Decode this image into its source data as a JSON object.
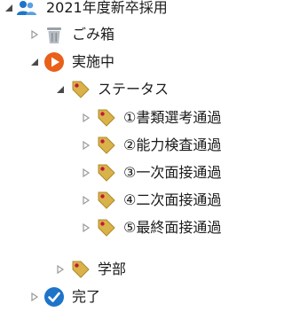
{
  "tree": {
    "root": {
      "label": "2021年度新卒採用",
      "icon": "people-icon",
      "expanded": true
    },
    "trash": {
      "label": "ごみ箱",
      "icon": "trash-icon",
      "expanded": false
    },
    "in_progress": {
      "label": "実施中",
      "icon": "play-circle-icon",
      "expanded": true
    },
    "status": {
      "label": "ステータス",
      "icon": "tag-icon",
      "expanded": true
    },
    "status_children": [
      {
        "label": "①書類選考通過",
        "icon": "tag-icon"
      },
      {
        "label": "②能力検査通過",
        "icon": "tag-icon"
      },
      {
        "label": "③一次面接通過",
        "icon": "tag-icon"
      },
      {
        "label": "④二次面接通過",
        "icon": "tag-icon"
      },
      {
        "label": "⑤最終面接通過",
        "icon": "tag-icon"
      }
    ],
    "department": {
      "label": "学部",
      "icon": "tag-icon",
      "expanded": false
    },
    "done": {
      "label": "完了",
      "icon": "check-circle-icon",
      "expanded": false
    }
  },
  "colors": {
    "people": "#1e74c9",
    "trash": "#9aa1a8",
    "play": "#e8601a",
    "tag": "#d9b24a",
    "tag_dot": "#c2183a",
    "check": "#1e74c9",
    "arrow_expanded": "#4a4a4a",
    "arrow_collapsed": "#9a9a9a"
  }
}
